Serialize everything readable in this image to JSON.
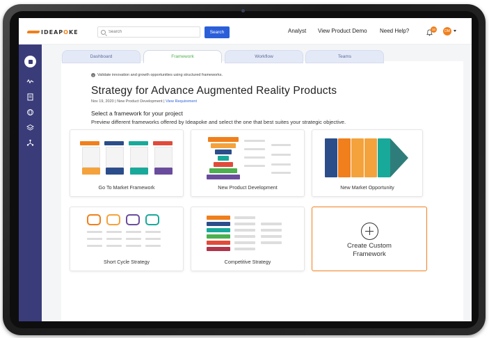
{
  "brand": {
    "logo_text_a": "IDEAP",
    "logo_text_o": "O",
    "logo_text_b": "KE"
  },
  "search": {
    "placeholder": "Search",
    "button": "Search"
  },
  "nav": {
    "analyst": "Analyst",
    "demo": "View Product Demo",
    "help": "Need Help?"
  },
  "notifications": {
    "count": "10"
  },
  "user": {
    "initials": "DM"
  },
  "tabs": [
    {
      "label": "Dashboard"
    },
    {
      "label": "Framework"
    },
    {
      "label": "Workflow"
    },
    {
      "label": "Teams"
    }
  ],
  "info": {
    "text": "Validate innovation and growth opportunities using structured frameworks."
  },
  "page": {
    "title": "Strategy for Advance Augmented Reality Products",
    "date": "Nov 19, 2020",
    "category": "New Product Development",
    "requirement_link": "View Requirement"
  },
  "select": {
    "heading": "Select a framework for your project",
    "sub": "Preview different frameworks offered by Ideapoke and select the one that best suites your strategic objective."
  },
  "frameworks": [
    {
      "label": "Go To Market Framework"
    },
    {
      "label": "New Product Development"
    },
    {
      "label": "New Market Opportunity"
    },
    {
      "label": "Short Cycle Strategy"
    },
    {
      "label": "Competitive Strategy"
    }
  ],
  "custom": {
    "line1": "Create Custom",
    "line2": "Framework"
  },
  "colors": {
    "accent": "#f07f1c",
    "primary": "#2b5fd9",
    "sidebar": "#3a3c7a",
    "active_tab": "#4caf50"
  }
}
